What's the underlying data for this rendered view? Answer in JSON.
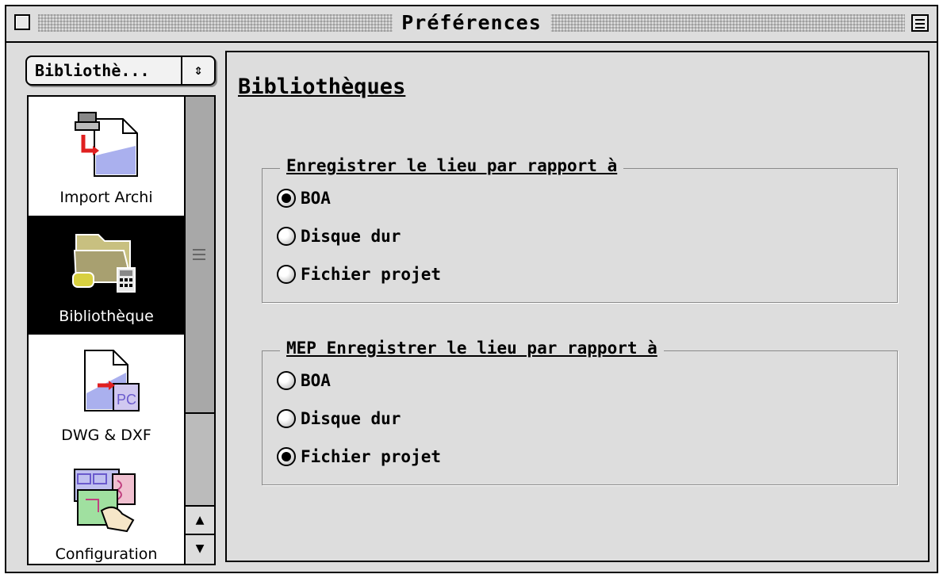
{
  "window": {
    "title": "Préférences"
  },
  "sidebar": {
    "popup_label": "Bibliothè...",
    "popup_arrows": "⇕",
    "items": [
      {
        "label": "Import Archi",
        "selected": false
      },
      {
        "label": "Bibliothèque",
        "selected": true
      },
      {
        "label": "DWG & DXF",
        "selected": false
      },
      {
        "label": "Configuration",
        "selected": false
      }
    ],
    "scroll_up": "▲",
    "scroll_down": "▼"
  },
  "main": {
    "title": "Bibliothèques",
    "groups": [
      {
        "title": "Enregistrer le lieu par rapport à",
        "options": [
          {
            "label": "BOA",
            "checked": true
          },
          {
            "label": "Disque dur",
            "checked": false
          },
          {
            "label": "Fichier projet",
            "checked": false
          }
        ]
      },
      {
        "title": "MEP Enregistrer le lieu par rapport à",
        "options": [
          {
            "label": "BOA",
            "checked": false
          },
          {
            "label": "Disque dur",
            "checked": false
          },
          {
            "label": "Fichier projet",
            "checked": true
          }
        ]
      }
    ]
  }
}
